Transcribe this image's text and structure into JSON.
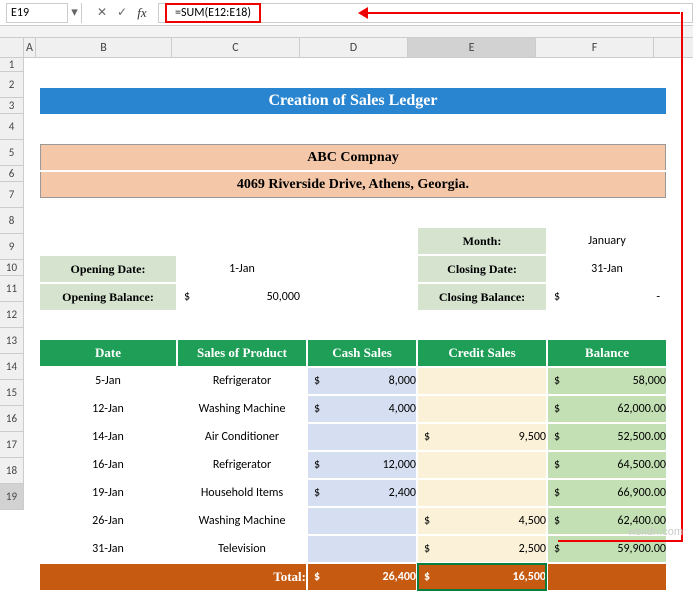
{
  "name_box": "E19",
  "formula": "=SUM(E12:E18)",
  "columns": [
    "A",
    "B",
    "C",
    "D",
    "E",
    "F"
  ],
  "rows": [
    "1",
    "2",
    "3",
    "4",
    "5",
    "6",
    "7",
    "8",
    "9",
    "10",
    "11",
    "12",
    "13",
    "14",
    "15",
    "16",
    "17",
    "18",
    "19"
  ],
  "title": "Creation of Sales Ledger",
  "company_name": "ABC Compnay",
  "company_address": "4069 Riverside Drive, Athens, Georgia.",
  "month_label": "Month:",
  "month_value": "January",
  "opening_date_label": "Opening Date:",
  "opening_date_value": "1-Jan",
  "closing_date_label": "Closing Date:",
  "closing_date_value": "31-Jan",
  "opening_bal_label": "Opening Balance:",
  "opening_bal_value": "50,000",
  "closing_bal_label": "Closing Balance:",
  "closing_bal_value": "-",
  "currency": "$",
  "headers": {
    "date": "Date",
    "product": "Sales of Product",
    "cash": "Cash Sales",
    "credit": "Credit Sales",
    "balance": "Balance"
  },
  "data": [
    {
      "date": "5-Jan",
      "product": "Refrigerator",
      "cash": "8,000",
      "credit": "",
      "balance": "58,000"
    },
    {
      "date": "12-Jan",
      "product": "Washing Machine",
      "cash": "4,000",
      "credit": "",
      "balance": "62,000.00"
    },
    {
      "date": "14-Jan",
      "product": "Air Conditioner",
      "cash": "",
      "credit": "9,500",
      "balance": "52,500.00"
    },
    {
      "date": "16-Jan",
      "product": "Refrigerator",
      "cash": "12,000",
      "credit": "",
      "balance": "64,500.00"
    },
    {
      "date": "19-Jan",
      "product": "Household Items",
      "cash": "2,400",
      "credit": "",
      "balance": "66,900.00"
    },
    {
      "date": "26-Jan",
      "product": "Washing Machine",
      "cash": "",
      "credit": "4,500",
      "balance": "62,400.00"
    },
    {
      "date": "31-Jan",
      "product": "Television",
      "cash": "",
      "credit": "2,500",
      "balance": "59,900.00"
    }
  ],
  "total_label": "Total:",
  "total_cash": "26,400",
  "total_credit": "16,500",
  "watermark": "wsxdn.com",
  "chart_data": {
    "type": "table",
    "title": "Creation of Sales Ledger",
    "columns": [
      "Date",
      "Sales of Product",
      "Cash Sales",
      "Credit Sales",
      "Balance"
    ],
    "rows": [
      [
        "5-Jan",
        "Refrigerator",
        8000,
        null,
        58000
      ],
      [
        "12-Jan",
        "Washing Machine",
        4000,
        null,
        62000
      ],
      [
        "14-Jan",
        "Air Conditioner",
        null,
        9500,
        52500
      ],
      [
        "16-Jan",
        "Refrigerator",
        12000,
        null,
        64500
      ],
      [
        "19-Jan",
        "Household Items",
        2400,
        null,
        66900
      ],
      [
        "26-Jan",
        "Washing Machine",
        null,
        4500,
        62400
      ],
      [
        "31-Jan",
        "Television",
        null,
        2500,
        59900
      ]
    ],
    "totals": {
      "Cash Sales": 26400,
      "Credit Sales": 16500
    },
    "opening_balance": 50000,
    "currency": "USD"
  }
}
